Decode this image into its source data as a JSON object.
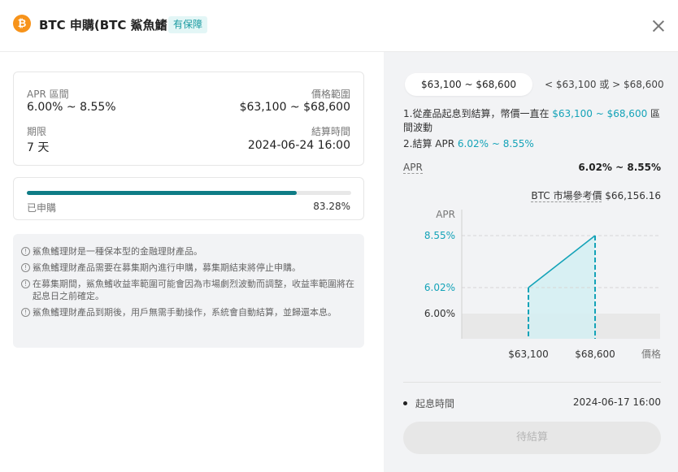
{
  "header": {
    "coin_glyph": "₿",
    "title": "BTC 申購(BTC 鯊魚鰭)",
    "badge": "有保障"
  },
  "info": {
    "apr_label": "APR 區間",
    "apr_value": "6.00% ~ 8.55%",
    "price_range_label": "價格範圍",
    "price_range_value": "$63,100 ~ $68,600",
    "term_label": "期限",
    "term_value": "7 天",
    "settle_label": "結算時間",
    "settle_value": "2024-06-24 16:00"
  },
  "progress": {
    "label": "已申購",
    "percent_text": "83.28%",
    "fraction": 0.8328
  },
  "notices": [
    "鯊魚鰭理財是一種保本型的金融理財產品。",
    "鯊魚鰭理財產品需要在募集期內進行申購，募集期結束將停止申購。",
    "在募集期間，鯊魚鰭收益率範圍可能會因為市場劇烈波動而調整，收益率範圍將在起息日之前確定。",
    "鯊魚鰭理財產品到期後，用戶無需手動操作，系統會自動結算，並歸還本息。"
  ],
  "tabs": {
    "active": "$63,100 ~ $68,600",
    "inactive": "< $63,100 或 > $68,600"
  },
  "description": {
    "line1_pre": "1.從產品起息到結算，幣價一直在",
    "line1_hl": "$63,100 ~ $68,600",
    "line1_post": "區間波動",
    "line2_pre": "2.結算 APR",
    "line2_hl": "6.02% ~ 8.55%"
  },
  "apr_row": {
    "label": "APR",
    "value": "6.02% ~ 8.55%"
  },
  "market_ref": {
    "label": "BTC 市場參考價",
    "value": "$66,156.16"
  },
  "chart_data": {
    "type": "area",
    "ylabel": "APR",
    "xlabel": "價格",
    "y_ticks": [
      "8.55%",
      "6.02%",
      "6.00%"
    ],
    "y_tick_values": [
      8.55,
      6.02,
      6.0
    ],
    "x_ticks": [
      "$63,100",
      "$68,600"
    ],
    "x_tick_values": [
      63100,
      68600
    ],
    "base_apr": 6.0,
    "x": [
      63100,
      68600
    ],
    "y": [
      6.02,
      8.55
    ],
    "colors": {
      "line": "#14a3b8",
      "fill": "#d3eef2",
      "base_fill": "#e8e8e8",
      "tick_highlight": "#14a3b8"
    }
  },
  "start_time": {
    "label": "起息時間",
    "value": "2024-06-17 16:00"
  },
  "action": {
    "label": "待結算"
  }
}
